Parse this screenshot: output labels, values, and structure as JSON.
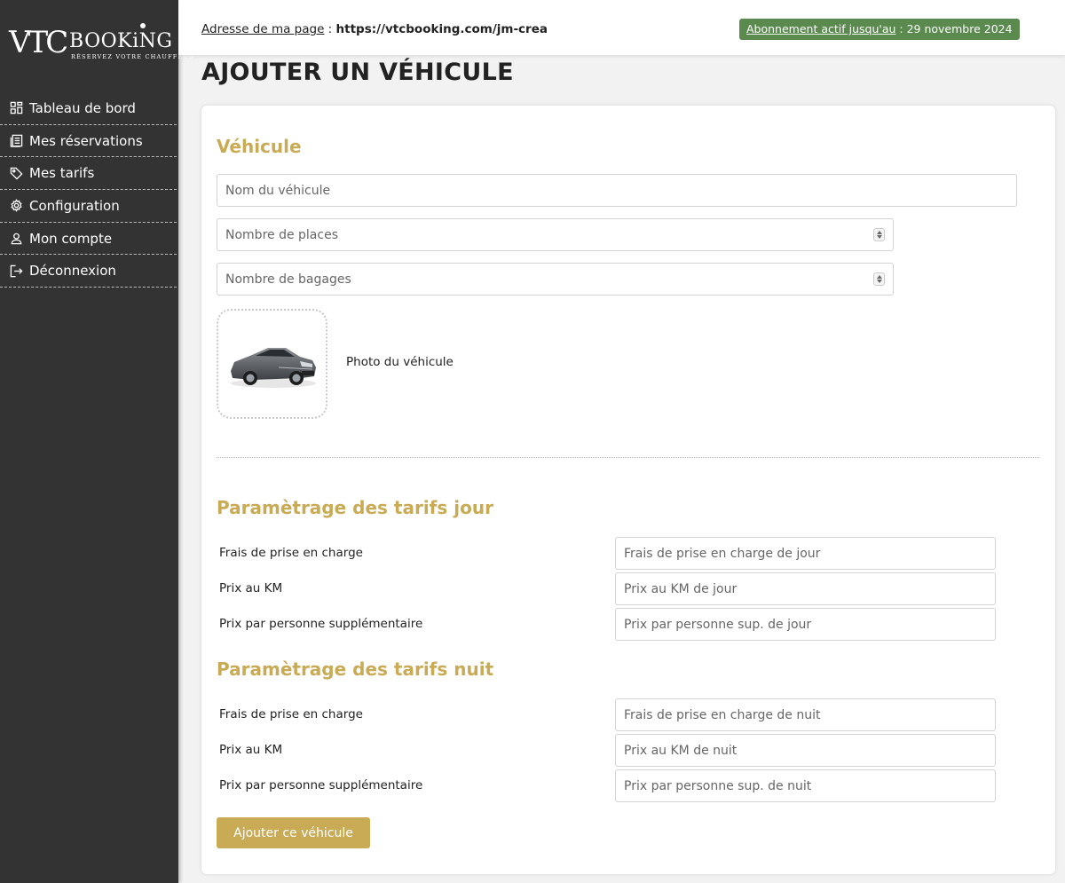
{
  "brand": {
    "logo_vtc": "VTC",
    "logo_booking": "BOOKiNG",
    "logo_tagline": "RÉSERVEZ VOTRE CHAUFFEUR"
  },
  "sidebar": {
    "items": [
      {
        "label": "Tableau de bord",
        "icon": "dashboard-icon"
      },
      {
        "label": "Mes réservations",
        "icon": "reservations-icon"
      },
      {
        "label": "Mes tarifs",
        "icon": "tag-icon"
      },
      {
        "label": "Configuration",
        "icon": "gear-icon"
      },
      {
        "label": "Mon compte",
        "icon": "user-icon"
      },
      {
        "label": "Déconnexion",
        "icon": "logout-icon"
      }
    ]
  },
  "header": {
    "address_label": "Adresse de ma page",
    "address_separator": " : ",
    "address_url": "https://vtcbooking.com/jm-crea",
    "subscription_label": "Abonnement actif jusqu'au",
    "subscription_separator": " : ",
    "subscription_date": "29 novembre 2024"
  },
  "page": {
    "title": "AJOUTER UN VÉHICULE"
  },
  "vehicle": {
    "section_title": "Véhicule",
    "name_placeholder": "Nom du véhicule",
    "seats_placeholder": "Nombre de places",
    "luggage_placeholder": "Nombre de bagages",
    "photo_label": "Photo du véhicule"
  },
  "day_rates": {
    "section_title": "Paramètrage des tarifs jour",
    "rows": [
      {
        "label": "Frais de prise en charge",
        "placeholder": "Frais de prise en charge de jour"
      },
      {
        "label": "Prix au KM",
        "placeholder": "Prix au KM de jour"
      },
      {
        "label": "Prix par personne supplémentaire",
        "placeholder": "Prix par personne sup. de jour"
      }
    ]
  },
  "night_rates": {
    "section_title": "Paramètrage des tarifs nuit",
    "rows": [
      {
        "label": "Frais de prise en charge",
        "placeholder": "Frais de prise en charge de nuit"
      },
      {
        "label": "Prix au KM",
        "placeholder": "Prix au KM de nuit"
      },
      {
        "label": "Prix par personne supplémentaire",
        "placeholder": "Prix par personne sup. de nuit"
      }
    ]
  },
  "actions": {
    "submit_label": "Ajouter ce véhicule"
  },
  "colors": {
    "sidebar_bg": "#333333",
    "accent_gold": "#c9aa55",
    "badge_green": "#5a8a4e"
  }
}
